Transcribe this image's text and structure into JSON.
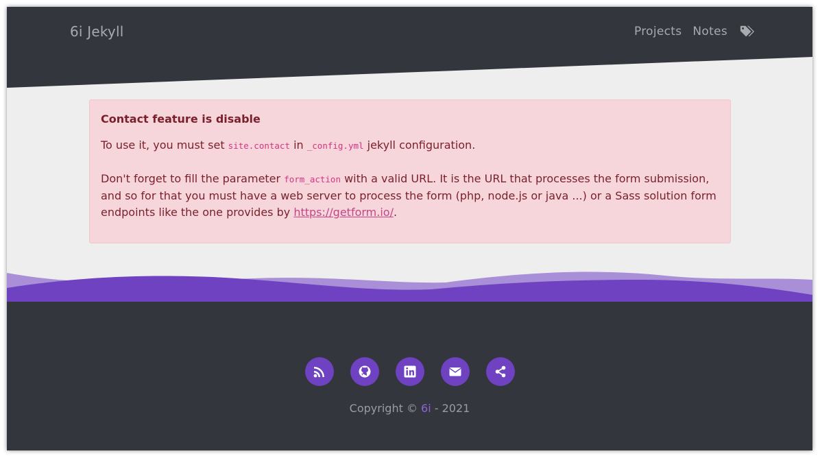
{
  "header": {
    "brand": "6i Jekyll",
    "nav": [
      {
        "label": "Projects"
      },
      {
        "label": "Notes"
      }
    ],
    "tags_icon": "tags-icon"
  },
  "alert": {
    "title": "Contact feature is disable",
    "p1_before": "To use it, you must set ",
    "p1_code1": "site.contact",
    "p1_mid": " in ",
    "p1_code2": "_config.yml",
    "p1_after": " jekyll configuration.",
    "p2_before": "Don't forget to fill the parameter ",
    "p2_code": "form_action",
    "p2_after": " with a valid URL. It is the URL that processes the form submission, and so for that you must have a web server to process the form (php, node.js or java ...) or a Sass solution form endpoints like the one provides by ",
    "p2_link": "https://getform.io/",
    "p2_end": "."
  },
  "footer": {
    "social": [
      {
        "icon": "rss-icon"
      },
      {
        "icon": "github-icon"
      },
      {
        "icon": "linkedin-icon"
      },
      {
        "icon": "envelope-icon"
      },
      {
        "icon": "share-icon"
      }
    ],
    "copyright_prefix": "Copyright © ",
    "copyright_owner": "6i",
    "copyright_suffix": " - 2021"
  },
  "colors": {
    "header_bg": "#33363d",
    "page_bg": "#eeeeee",
    "accent": "#6f42c1",
    "accent_light": "#a98fd8",
    "alert_bg": "#f6d6da",
    "alert_text": "#7a1f2b"
  }
}
